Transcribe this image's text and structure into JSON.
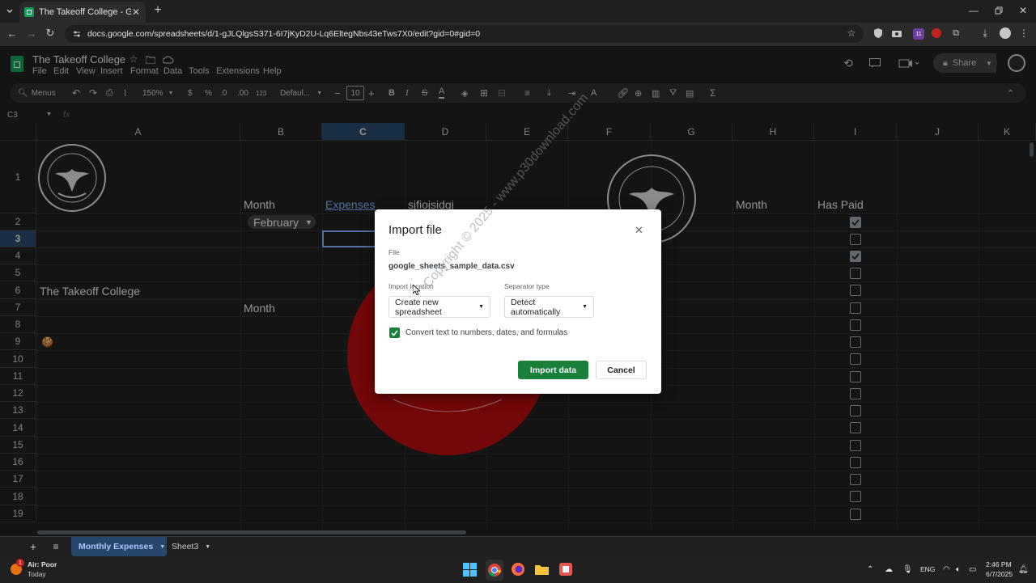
{
  "browser": {
    "tab_title": "The Takeoff College - Google Sh",
    "url": "docs.google.com/spreadsheets/d/1-gJLQlgsS371-6I7jKyD2U-Lq6EltegNbs43eTws7X0/edit?gid=0#gid=0",
    "extension_badge": "11"
  },
  "sheets": {
    "doc_title": "The Takeoff College",
    "menus": [
      "File",
      "Edit",
      "View",
      "Insert",
      "Format",
      "Data",
      "Tools",
      "Extensions",
      "Help"
    ],
    "share_label": "Share",
    "toolbar": {
      "search_label": "Menus",
      "zoom": "150%",
      "currency": "$",
      "percent": "%",
      "dec_dec": ".0",
      "dec_inc": ".00",
      "format_num": "123",
      "font": "Defaul...",
      "font_size": "10"
    },
    "name_box": "C3",
    "fx": "fx",
    "columns": [
      "A",
      "B",
      "C",
      "D",
      "E",
      "F",
      "G",
      "H",
      "I",
      "J",
      "K"
    ],
    "rows": [
      "1",
      "2",
      "3",
      "4",
      "5",
      "6",
      "7",
      "8",
      "9",
      "10",
      "11",
      "12",
      "13",
      "14",
      "15",
      "16",
      "17",
      "18",
      "19"
    ],
    "cells": {
      "b1": "Month",
      "c1": "Expenses",
      "d1": "sjfiojsidgj",
      "h1": "Month",
      "i1": "Has Paid",
      "b2": "February",
      "a6": "The Takeoff College",
      "b7": "Month",
      "a9_emoji": "🍪"
    },
    "checkboxes": [
      true,
      false,
      true,
      false,
      false,
      false,
      false,
      false,
      false,
      false,
      false,
      false,
      false,
      false,
      false,
      false,
      false,
      false
    ],
    "sheet_tabs": [
      "Monthly Expenses",
      "Sheet3"
    ]
  },
  "dialog": {
    "title": "Import file",
    "file_label": "File",
    "file_name": "google_sheets_sample_data.csv",
    "location_label": "Import location",
    "location_value": "Create new spreadsheet",
    "separator_label": "Separator type",
    "separator_value": "Detect automatically",
    "convert_label": "Convert text to numbers, dates, and formulas",
    "convert_checked": true,
    "import_label": "Import data",
    "cancel_label": "Cancel"
  },
  "watermark": "Copyright © 2025 - www.p30download.com",
  "taskbar": {
    "weather_title": "Air: Poor",
    "weather_sub": "Today",
    "weather_badge": "1",
    "lang": "ENG",
    "time": "2:46 PM",
    "date": "6/7/2025"
  },
  "colors": {
    "accent_green": "#188038",
    "link_blue": "#7cacf8",
    "pie_red": "#b30c0c"
  }
}
